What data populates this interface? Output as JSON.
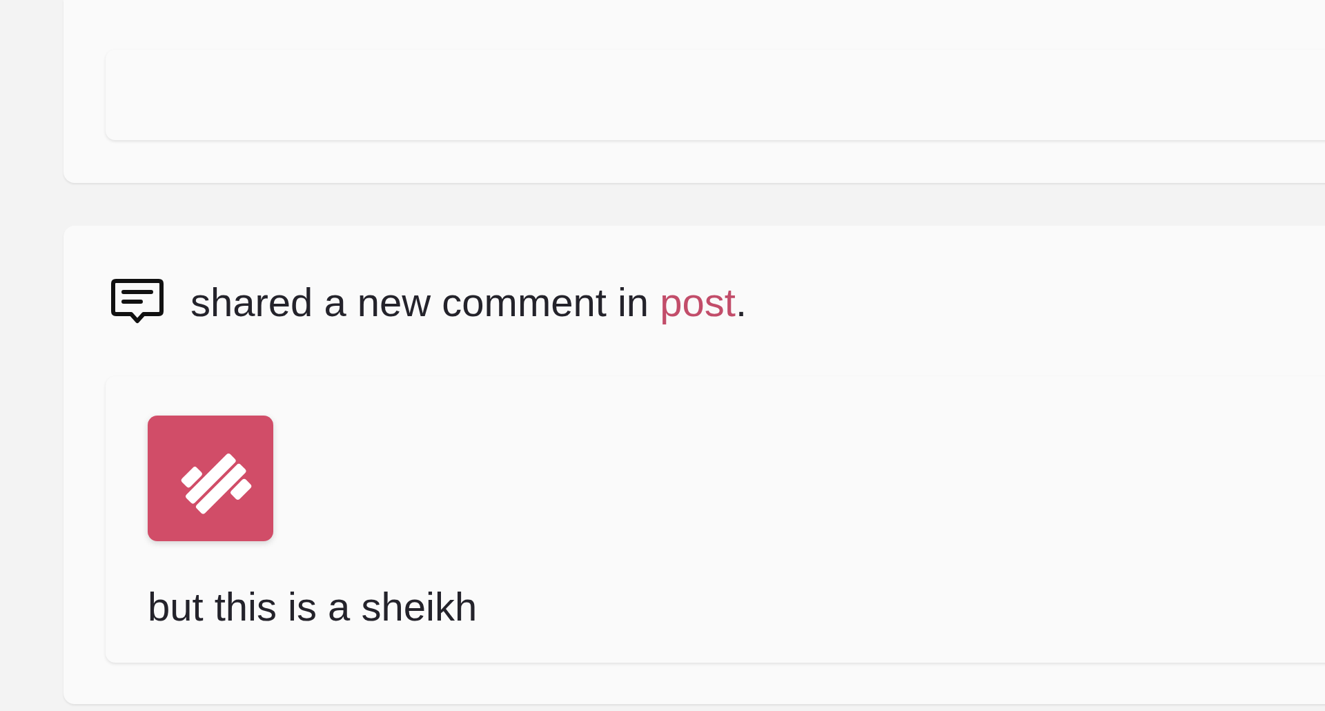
{
  "feed": [
    {
      "kind": "comment",
      "message": "shared a new comment in ",
      "link": "post",
      "after": ".",
      "comment": "but this is a sheikh"
    }
  ]
}
